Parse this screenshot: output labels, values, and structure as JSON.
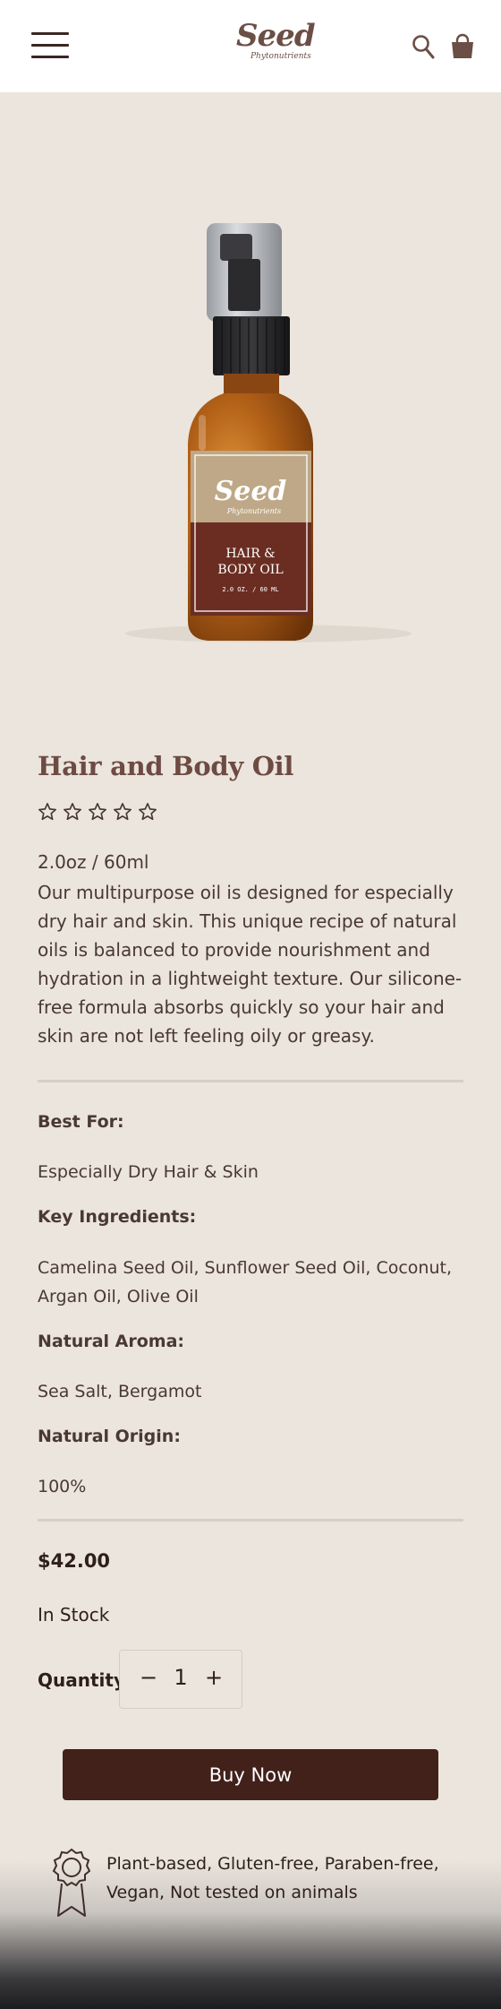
{
  "header": {
    "logo_text": "Seed",
    "logo_sub": "Phytonutrients",
    "icons": [
      "menu-icon",
      "search-icon",
      "shopping-bag-icon"
    ]
  },
  "product_image": {
    "label_brand": "Seed",
    "label_sub": "Phytonutrients",
    "label_line1": "HAIR &",
    "label_line2": "BODY OIL",
    "label_size": "2.0 OZ. / 60 ML"
  },
  "product": {
    "title": "Hair and Body Oil",
    "rating": 0,
    "rating_max": 5,
    "size": "2.0oz / 60ml",
    "description": "Our multipurpose oil is designed for especially dry hair and skin. This unique recipe of natural oils is balanced to provide nourishment and hydration in a lightweight texture. Our silicone-free formula absorbs quickly so your hair and skin are not left feeling oily or greasy."
  },
  "details": {
    "best_for_label": "Best For:",
    "best_for_value": "Especially Dry Hair & Skin",
    "ingredients_label": "Key Ingredients:",
    "ingredients_value": "Camelina Seed Oil, Sunflower Seed Oil, Coconut, Argan Oil, Olive Oil",
    "aroma_label": "Natural Aroma:",
    "aroma_value": "Sea Salt, Bergamot",
    "origin_label": "Natural Origin:",
    "origin_value": "100%"
  },
  "purchase": {
    "price": "$42.00",
    "stock": "In Stock",
    "quantity_label": "Quantity",
    "quantity_minus": "−",
    "quantity_value": "1",
    "quantity_plus": "+",
    "buy_label": "Buy Now"
  },
  "badge": {
    "icon": "award-ribbon-icon",
    "text": "Plant-based, Gluten-free, Paraben-free, Vegan, Not tested on animals"
  },
  "colors": {
    "background": "#ebe5dd",
    "header": "#ffffff",
    "title": "#6d4b43",
    "button": "#42211a",
    "text": "#4a3833"
  }
}
